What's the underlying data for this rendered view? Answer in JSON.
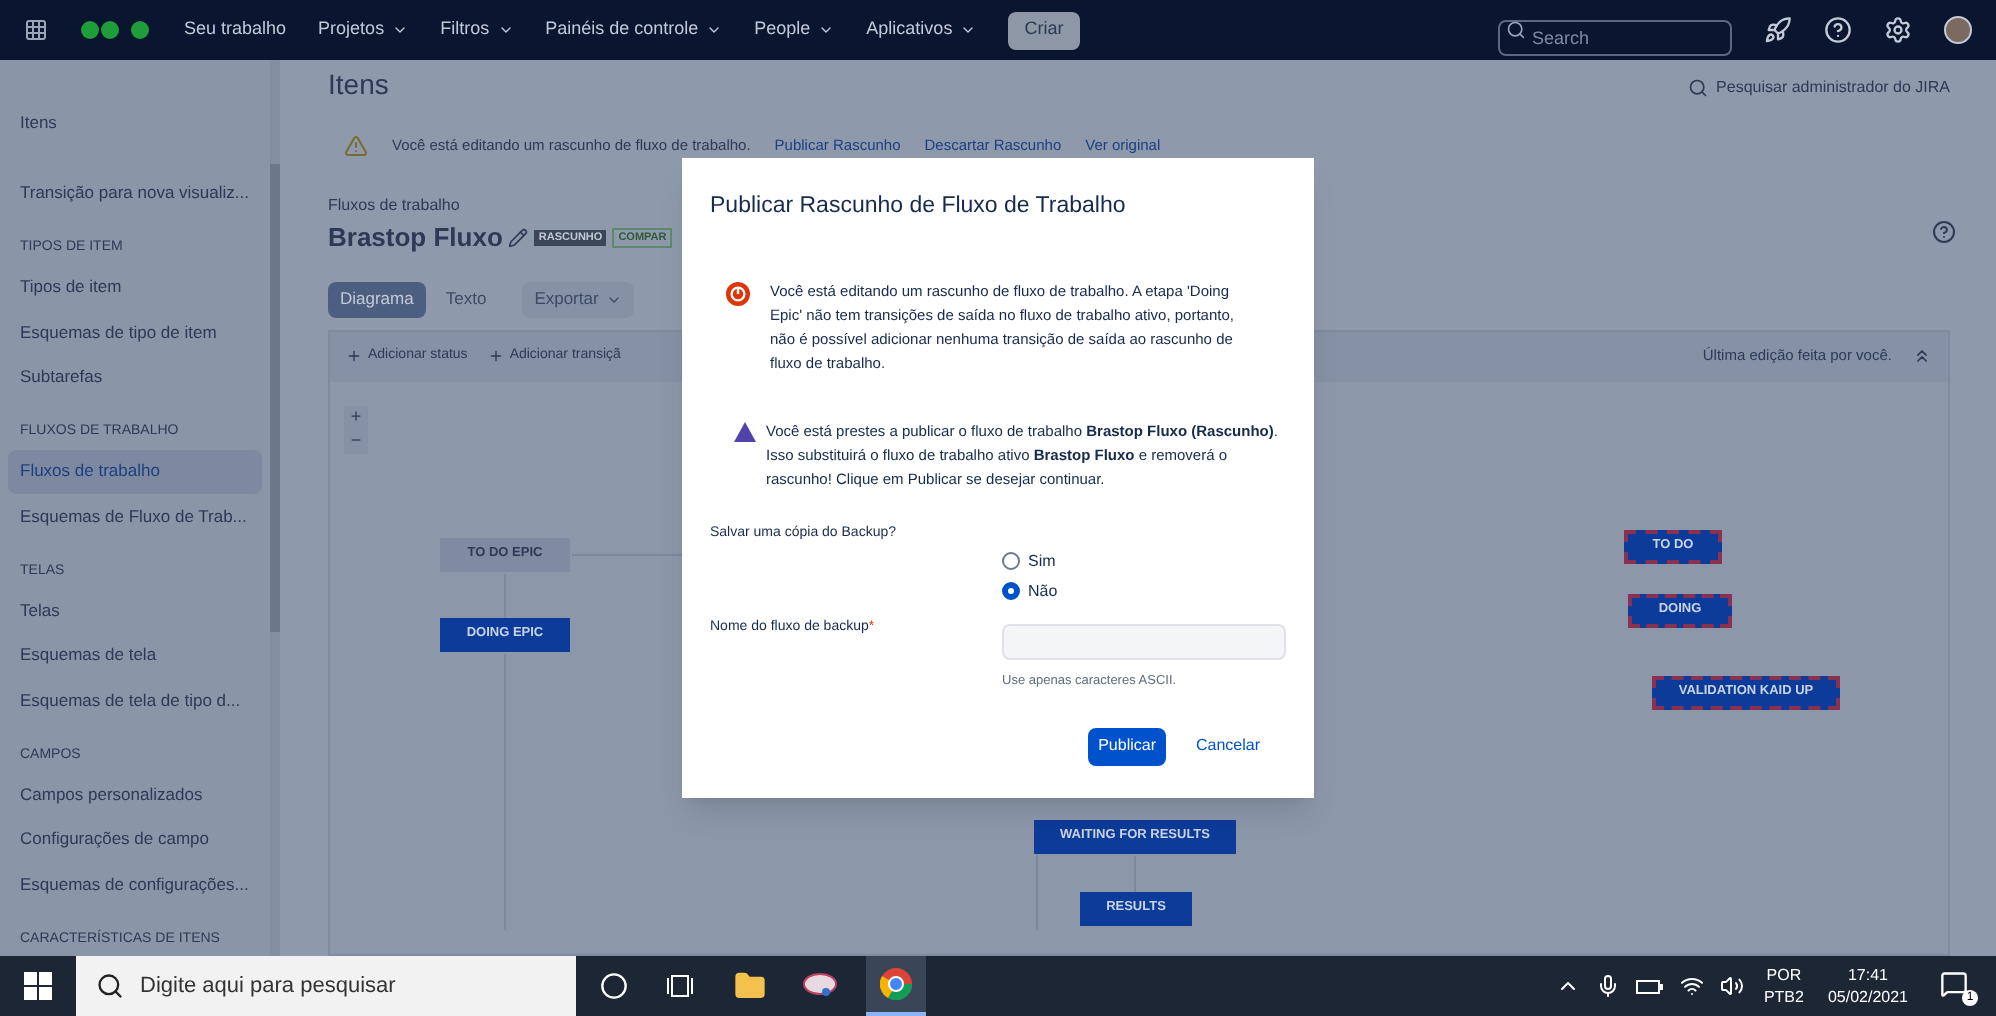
{
  "nav": {
    "items": [
      {
        "label": "Seu trabalho",
        "dropdown": false
      },
      {
        "label": "Projetos",
        "dropdown": true
      },
      {
        "label": "Filtros",
        "dropdown": true
      },
      {
        "label": "Painéis de controle",
        "dropdown": true
      },
      {
        "label": "People",
        "dropdown": true
      },
      {
        "label": "Aplicativos",
        "dropdown": true
      }
    ],
    "create": "Criar",
    "search_placeholder": "Search"
  },
  "sidebar": {
    "items": [
      {
        "kind": "link",
        "label": "Itens",
        "selected": false
      },
      {
        "kind": "link",
        "label": "Transição para nova visualiz...",
        "selected": false
      },
      {
        "kind": "section",
        "label": "TIPOS DE ITEM"
      },
      {
        "kind": "link",
        "label": "Tipos de item",
        "selected": false
      },
      {
        "kind": "link",
        "label": "Esquemas de tipo de item",
        "selected": false
      },
      {
        "kind": "link",
        "label": "Subtarefas",
        "selected": false
      },
      {
        "kind": "section",
        "label": "FLUXOS DE TRABALHO"
      },
      {
        "kind": "link",
        "label": "Fluxos de trabalho",
        "selected": true
      },
      {
        "kind": "link",
        "label": "Esquemas de Fluxo de Trab...",
        "selected": false
      },
      {
        "kind": "section",
        "label": "TELAS"
      },
      {
        "kind": "link",
        "label": "Telas",
        "selected": false
      },
      {
        "kind": "link",
        "label": "Esquemas de tela",
        "selected": false
      },
      {
        "kind": "link",
        "label": "Esquemas de tela de tipo d...",
        "selected": false
      },
      {
        "kind": "section",
        "label": "CAMPOS"
      },
      {
        "kind": "link",
        "label": "Campos personalizados",
        "selected": false
      },
      {
        "kind": "link",
        "label": "Configurações de campo",
        "selected": false
      },
      {
        "kind": "link",
        "label": "Esquemas de configurações...",
        "selected": false
      },
      {
        "kind": "section",
        "label": "CARACTERÍSTICAS DE ITENS"
      }
    ]
  },
  "page": {
    "title": "Itens",
    "admin_search": "Pesquisar administrador do JIRA",
    "draft_banner": {
      "message": "Você está editando um rascunho de fluxo de trabalho.",
      "links": [
        "Publicar Rascunho",
        "Descartar Rascunho",
        "Ver original"
      ]
    },
    "breadcrumb": "Fluxos de trabalho",
    "workflow_title": "Brastop Fluxo",
    "badges": [
      {
        "label": "RASCUNHO",
        "kind": "draft"
      },
      {
        "label": "COMPAR",
        "kind": "shared"
      }
    ],
    "tabs": [
      {
        "label": "Diagrama",
        "selected": true,
        "dropdown": false
      },
      {
        "label": "Texto",
        "selected": false,
        "dropdown": false
      },
      {
        "label": "Exportar",
        "selected": false,
        "dropdown": true
      }
    ],
    "toolbar": [
      "Adicionar status",
      "Adicionar transiçã"
    ],
    "last_edit": "Última edição feita por você.",
    "zoom": [
      "+",
      "−"
    ],
    "nodes": [
      {
        "label": "TO DO EPIC",
        "kind": "initial",
        "selected": false
      },
      {
        "label": "DOING EPIC",
        "kind": "status",
        "selected": false
      },
      {
        "label": "TO DO",
        "kind": "status",
        "selected": true
      },
      {
        "label": "DOING",
        "kind": "status",
        "selected": true
      },
      {
        "label": "VALIDATION KAID UP",
        "kind": "status",
        "selected": true
      },
      {
        "label": "WAITING FOR RESULTS",
        "kind": "status",
        "selected": false
      },
      {
        "label": "RESULTS",
        "kind": "status",
        "selected": false
      }
    ]
  },
  "dialog": {
    "title": "Publicar Rascunho de Fluxo de Trabalho",
    "error": "Você está editando um rascunho de fluxo de trabalho. A etapa 'Doing Epic' não tem transições de saída no fluxo de trabalho ativo, portanto, não é possível adicionar nenhuma transição de saída ao rascunho de fluxo de trabalho.",
    "warning": "Você está prestes a publicar o fluxo de trabalho **Brastop Fluxo (Rascunho)**. Isso substituirá o fluxo de trabalho ativo **Brastop Fluxo** e removerá o rascunho! Clique em Publicar se desejar continuar.",
    "backup_question": "Salvar uma cópia do Backup?",
    "options": [
      {
        "label": "Sim",
        "selected": false
      },
      {
        "label": "Não",
        "selected": true
      }
    ],
    "field": {
      "label": "Nome do fluxo de backup",
      "required_marker": "*",
      "hint": "Use apenas caracteres ASCII."
    },
    "buttons": [
      {
        "label": "Publicar",
        "kind": "primary"
      },
      {
        "label": "Cancelar",
        "kind": "link"
      }
    ]
  },
  "taskbar": {
    "search_placeholder": "Digite aqui para pesquisar",
    "language": "POR",
    "layout": "PTB2",
    "time": "17:41",
    "date": "05/02/2021",
    "notifications": "1"
  }
}
